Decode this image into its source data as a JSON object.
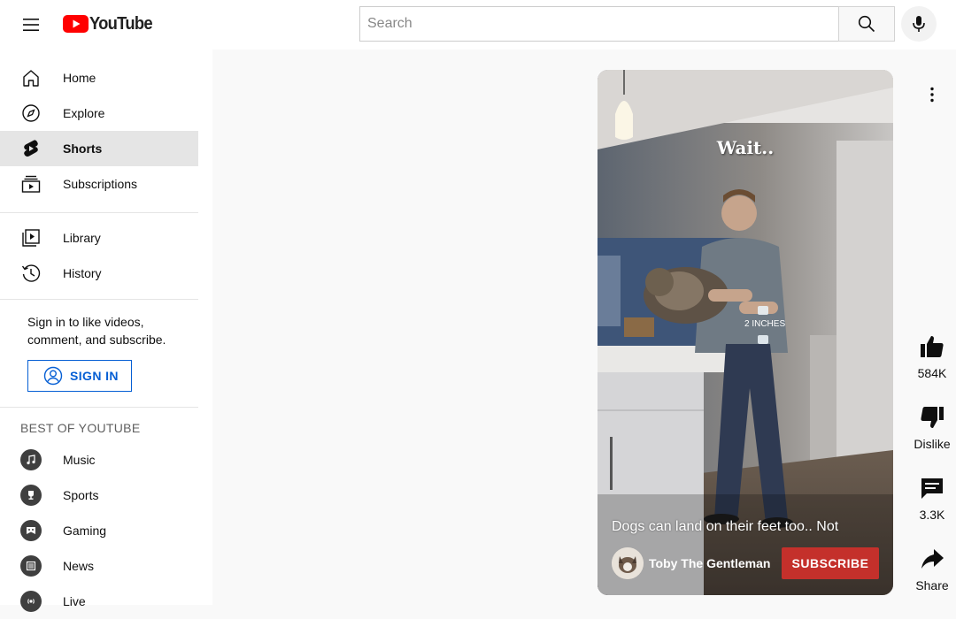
{
  "header": {
    "logo_text": "YouTube",
    "search_placeholder": "Search"
  },
  "sidebar": {
    "primary": [
      {
        "label": "Home",
        "icon": "home-icon"
      },
      {
        "label": "Explore",
        "icon": "compass-icon"
      },
      {
        "label": "Shorts",
        "icon": "shorts-icon",
        "active": true
      },
      {
        "label": "Subscriptions",
        "icon": "subscriptions-icon"
      }
    ],
    "secondary": [
      {
        "label": "Library",
        "icon": "library-icon"
      },
      {
        "label": "History",
        "icon": "history-icon"
      }
    ],
    "signin_prompt": "Sign in to like videos, comment, and subscribe.",
    "signin_label": "SIGN IN",
    "best_of_title": "BEST OF YOUTUBE",
    "best_of": [
      {
        "label": "Music",
        "icon": "music-icon"
      },
      {
        "label": "Sports",
        "icon": "trophy-icon"
      },
      {
        "label": "Gaming",
        "icon": "gamepad-icon"
      },
      {
        "label": "News",
        "icon": "newspaper-icon"
      },
      {
        "label": "Live",
        "icon": "live-icon"
      }
    ]
  },
  "short": {
    "overlay_text": "Wait..",
    "inch_label": "2 INCHES",
    "caption": "Dogs can land on their feet too.. Not",
    "channel_name": "Toby The Gentleman",
    "subscribe_label": "SUBSCRIBE"
  },
  "actions": {
    "like_count": "584K",
    "dislike_label": "Dislike",
    "comment_count": "3.3K",
    "share_label": "Share"
  },
  "colors": {
    "brand_red": "#ff0000",
    "subscribe_red": "#c4302b",
    "link_blue": "#065fd4",
    "active_bg": "#e5e5e5"
  }
}
